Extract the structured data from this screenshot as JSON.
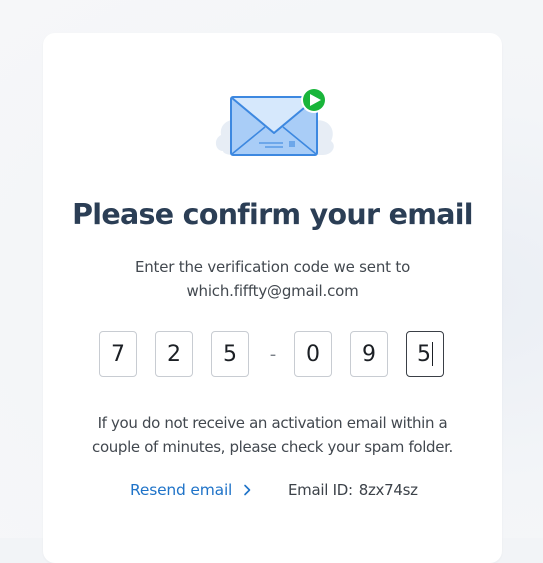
{
  "confirm_email": {
    "title": "Please confirm your email",
    "instruction": "Enter the verification code we sent to",
    "email_address": "which.fiffty@gmail.com",
    "code_digits": [
      "7",
      "2",
      "5",
      "0",
      "9",
      "5"
    ],
    "code_separator": "-",
    "notice_line_1": "If you do not receive an activation email within a",
    "notice_line_2": "couple of minutes, please check your spam folder.",
    "resend_label": "Resend email",
    "email_id_label": "Email ID:",
    "email_id_value": "8zx74sz"
  },
  "icons": {
    "illustration": "envelope-with-play-badge-icon",
    "resend": "chevron-right-icon"
  },
  "colors": {
    "background": "#f2f4f7",
    "card": "#ffffff",
    "title": "#2b3e55",
    "body_text": "#42484f",
    "link": "#1f73c8",
    "envelope_fill": "#a9cdf7",
    "envelope_stroke": "#3d88e0",
    "badge": "#19b53a",
    "input_border": "#c8ccd2",
    "input_active_border": "#3a3f46"
  }
}
